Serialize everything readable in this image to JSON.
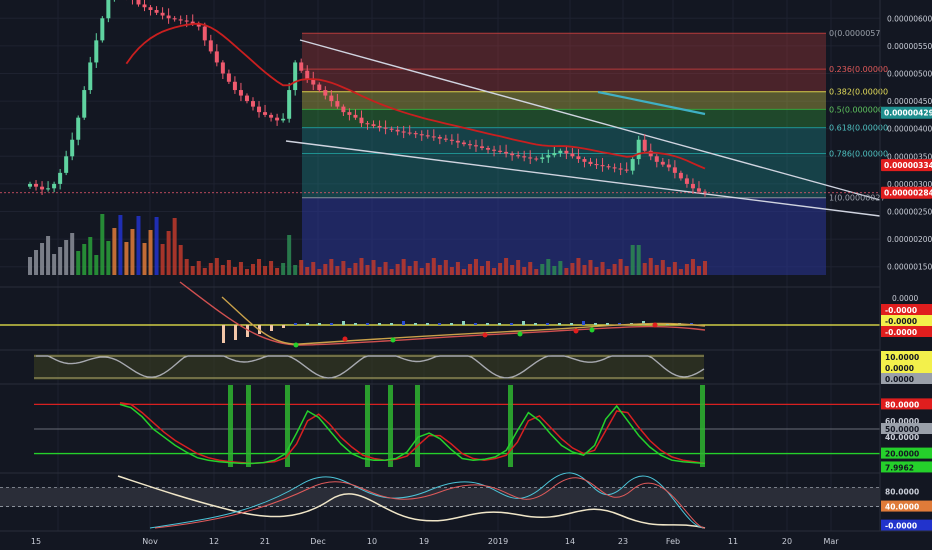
{
  "colors": {
    "background": "#131722",
    "up": "#5fd3a0",
    "down": "#ef5a6e",
    "grid": "#1e2230",
    "axis_text": "#c8ccd6",
    "fib_red": "#b33a3a",
    "fib_yellow": "#d7d24a",
    "fib_green": "#36a23c",
    "fib_teal": "#1e8f8f",
    "fib_blue": "#2a3596",
    "ema": "#c91f1f",
    "white_line": "#d0d4e0",
    "cyan_line": "#3fb0c4",
    "badge_red": "#e01e1e",
    "badge_yellow": "#f3f04b",
    "badge_green": "#25d02b",
    "badge_gray": "#9aa0aa"
  },
  "chart_data": [
    {
      "type": "candlestick",
      "panel": "price",
      "y_ticks": [
        "0.00000600",
        "0.00000550",
        "0.00000500",
        "0.00000450",
        "0.00000400",
        "0.00000350",
        "0.00000300",
        "0.00000250",
        "0.00000200",
        "0.00000150"
      ],
      "y_tick_values": [
        600,
        550,
        500,
        450,
        400,
        350,
        300,
        250,
        200,
        150
      ],
      "ylim": [
        135,
        615
      ],
      "y_unit_scale": "1e-8",
      "price_badges": [
        {
          "value": 429,
          "text": "0.00000429",
          "style": "teal"
        },
        {
          "value": 334,
          "text": "0.00000334",
          "style": "red"
        },
        {
          "value": 284,
          "text": "0.00000284",
          "style": "red"
        }
      ],
      "fib_levels": [
        {
          "ratio_label": "0(0.0000057",
          "value": 573
        },
        {
          "ratio_label": "0.236(0.00000",
          "value": 508
        },
        {
          "ratio_label": "0.382(0.00000",
          "value": 467
        },
        {
          "ratio_label": "0.5(0.000000",
          "value": 435
        },
        {
          "ratio_label": "0.618(0.00000",
          "value": 402
        },
        {
          "ratio_label": "0.786(0.00000",
          "value": 355
        },
        {
          "ratio_label": "1(0.00000027",
          "value": 275
        }
      ],
      "closes": [
        300,
        295,
        290,
        292,
        300,
        320,
        350,
        380,
        420,
        470,
        520,
        560,
        600,
        640,
        660,
        650,
        640,
        635,
        625,
        620,
        615,
        610,
        605,
        600,
        598,
        596,
        594,
        590,
        585,
        560,
        540,
        520,
        500,
        485,
        470,
        460,
        450,
        440,
        430,
        425,
        420,
        415,
        418,
        470,
        520,
        505,
        490,
        480,
        470,
        460,
        450,
        440,
        430,
        425,
        420,
        410,
        408,
        405,
        402,
        400,
        398,
        395,
        393,
        392,
        390,
        388,
        386,
        385,
        382,
        380,
        378,
        375,
        372,
        370,
        368,
        365,
        362,
        360,
        358,
        355,
        352,
        350,
        348,
        346,
        345,
        348,
        352,
        356,
        360,
        355,
        350,
        345,
        340,
        336,
        334,
        332,
        330,
        328,
        326,
        324,
        345,
        380,
        360,
        350,
        340,
        335,
        330,
        320,
        310,
        300,
        292,
        286,
        284
      ]
    },
    {
      "type": "line",
      "panel": "macd",
      "y_ticks": [
        "0.0000"
      ],
      "badges": [
        "-0.0000",
        "-0.0000",
        "-0.0000"
      ]
    },
    {
      "type": "line",
      "panel": "stoch_rsi_top",
      "badges": [
        "10.0000",
        "0.0000",
        "0.0000"
      ]
    },
    {
      "type": "line",
      "panel": "stoch",
      "y_ticks": [
        "80.0000",
        "60.0000",
        "50.0000",
        "40.0000",
        "20.0000",
        "7.9962"
      ],
      "y_tick_values": [
        80,
        60,
        50,
        40,
        20,
        7.9962
      ],
      "ylim": [
        0,
        100
      ],
      "fast_values": [
        80,
        76,
        65,
        50,
        40,
        30,
        22,
        15,
        12,
        10,
        9,
        8,
        8,
        9,
        12,
        20,
        45,
        72,
        64,
        48,
        32,
        20,
        14,
        12,
        12,
        14,
        22,
        40,
        45,
        38,
        25,
        14,
        12,
        13,
        16,
        24,
        48,
        70,
        60,
        44,
        30,
        22,
        18,
        30,
        62,
        78,
        60,
        42,
        28,
        18,
        12,
        10,
        9,
        8
      ],
      "slow_values": [
        82,
        80,
        70,
        58,
        46,
        36,
        28,
        20,
        15,
        12,
        10,
        9,
        8,
        9,
        10,
        15,
        32,
        60,
        68,
        56,
        40,
        28,
        18,
        14,
        12,
        13,
        17,
        30,
        42,
        42,
        32,
        20,
        14,
        12,
        14,
        18,
        34,
        60,
        66,
        52,
        38,
        27,
        20,
        24,
        48,
        72,
        70,
        52,
        36,
        24,
        16,
        12,
        10,
        8
      ]
    },
    {
      "type": "line",
      "panel": "rsi",
      "y_ticks": [
        "80.0000",
        "40.0000",
        "-0.0000"
      ],
      "y_tick_values": [
        80,
        40,
        0
      ],
      "ylim": [
        -5,
        100
      ]
    }
  ],
  "x_axis": {
    "labels": [
      "15",
      "Nov",
      "12",
      "21",
      "Dec",
      "10",
      "19",
      "2019",
      "14",
      "23",
      "Feb",
      "11",
      "20",
      "Mar"
    ]
  }
}
